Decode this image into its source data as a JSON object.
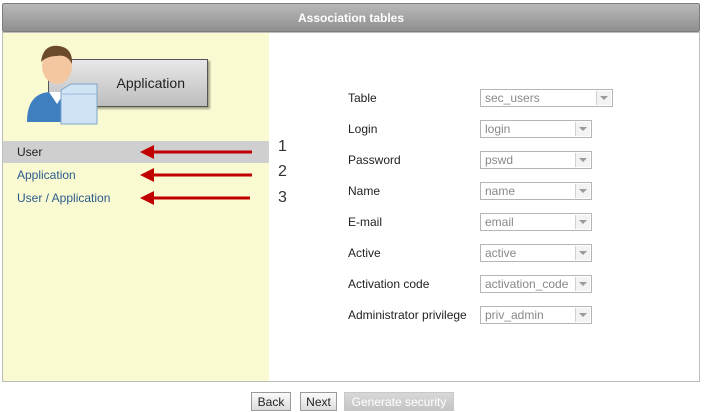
{
  "window": {
    "title": "Association tables"
  },
  "sidebar": {
    "header_label": "Application",
    "items": [
      {
        "label": "User",
        "active": true
      },
      {
        "label": "Application",
        "active": false
      },
      {
        "label": "User / Application",
        "active": false
      }
    ],
    "annotations": [
      "1",
      "2",
      "3"
    ],
    "arrow_color": "#c00000",
    "background_color": "#fafad2"
  },
  "form": {
    "fields": [
      {
        "label": "Table",
        "value": "sec_users"
      },
      {
        "label": "Login",
        "value": "login"
      },
      {
        "label": "Password",
        "value": "pswd"
      },
      {
        "label": "Name",
        "value": "name"
      },
      {
        "label": "E-mail",
        "value": "email"
      },
      {
        "label": "Active",
        "value": "active"
      },
      {
        "label": "Activation code",
        "value": "activation_code"
      },
      {
        "label": "Administrator privilege",
        "value": "priv_admin"
      }
    ]
  },
  "footer": {
    "back_label": "Back",
    "next_label": "Next",
    "generate_label": "Generate security"
  }
}
